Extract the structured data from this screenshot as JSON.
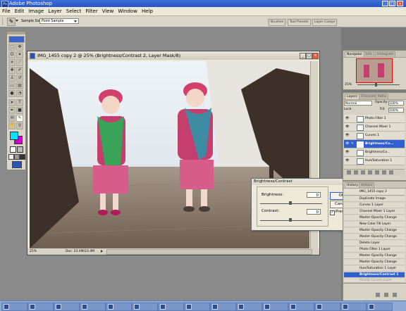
{
  "app": {
    "title": "Adobe Photoshop",
    "icon_label": "Ps"
  },
  "menu": [
    "File",
    "Edit",
    "Image",
    "Layer",
    "Select",
    "Filter",
    "View",
    "Window",
    "Help"
  ],
  "options_bar": {
    "sample_size_label": "Sample Size:",
    "sample_size_value": "Point Sample"
  },
  "palette_well": [
    "Brushes",
    "Tool Presets",
    "Layer Comps"
  ],
  "document": {
    "title": "IMG_1455 copy 2 @ 25% (Brightness/Contrast 2, Layer Mask/8)",
    "zoom": "25%",
    "doc_info": "Doc: 23.4M/23.4M"
  },
  "dialog": {
    "title": "Brightness/Contrast",
    "brightness_label": "Brightness:",
    "brightness_value": "0",
    "contrast_label": "Contrast:",
    "contrast_value": "0",
    "ok_label": "OK",
    "cancel_label": "Cancel",
    "preview_label": "Preview",
    "preview_checked": true
  },
  "navigator": {
    "tabs": [
      "Navigator",
      "Info",
      "Histogram"
    ],
    "zoom": "25%"
  },
  "layers": {
    "tabs": [
      "Layers",
      "Channels",
      "Paths"
    ],
    "blend_mode": "Normal",
    "opacity_label": "Opacity:",
    "opacity_value": "100%",
    "lock_label": "Lock:",
    "fill_label": "Fill:",
    "fill_value": "100%",
    "rows": [
      {
        "name": "Photo Filter 1",
        "selected": false
      },
      {
        "name": "Channel Mixer 1",
        "selected": false
      },
      {
        "name": "Curves 1",
        "selected": false
      },
      {
        "name": "Brightness/Co...",
        "selected": true
      },
      {
        "name": "Brightness/Co...",
        "selected": false
      },
      {
        "name": "Hue/Saturation 1",
        "selected": false
      }
    ]
  },
  "history": {
    "tabs": [
      "History",
      "Actions"
    ],
    "snapshot": "IMG_1455 copy 2",
    "items": [
      {
        "label": "Duplicate Image",
        "state": "normal"
      },
      {
        "label": "Curves 1 Layer",
        "state": "normal"
      },
      {
        "label": "Channel Mixer 1 Layer",
        "state": "normal"
      },
      {
        "label": "Master Opacity Change",
        "state": "normal"
      },
      {
        "label": "New Color Fill Layer",
        "state": "normal"
      },
      {
        "label": "Master Opacity Change",
        "state": "normal"
      },
      {
        "label": "Master Opacity Change",
        "state": "normal"
      },
      {
        "label": "Delete Layer",
        "state": "normal"
      },
      {
        "label": "Photo Filter 1 Layer",
        "state": "normal"
      },
      {
        "label": "Master Opacity Change",
        "state": "normal"
      },
      {
        "label": "Master Opacity Change",
        "state": "normal"
      },
      {
        "label": "Hue/Saturation 1 Layer",
        "state": "normal"
      },
      {
        "label": "Brightness/Contrast 1 Layer",
        "state": "selected"
      },
      {
        "label": "Modify Curves Layer",
        "state": "ghost"
      }
    ]
  },
  "colors": {
    "foreground": "#00e5ff",
    "background": "#d000d0",
    "titlebar": "#2a55c0",
    "selection": "#2f5fd0"
  }
}
